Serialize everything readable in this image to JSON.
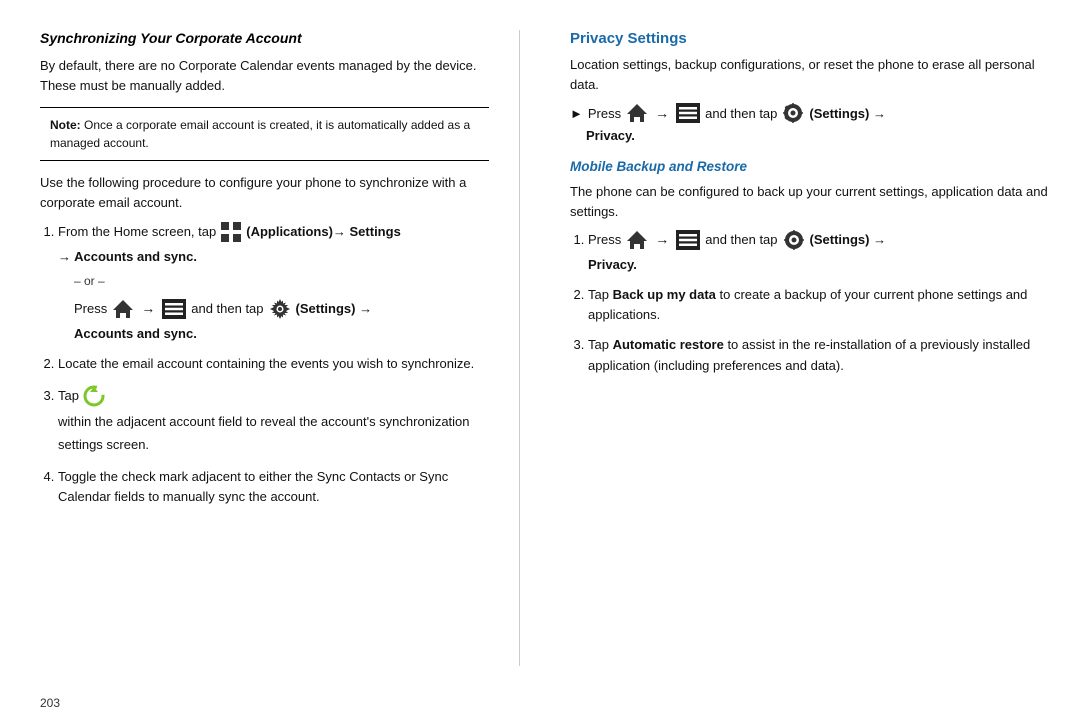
{
  "left": {
    "title": "Synchronizing Your Corporate Account",
    "intro": "By default, there are no Corporate Calendar events managed by the device. These must be manually added.",
    "note_label": "Note:",
    "note_text": "Once a corporate email account is created, it is automatically added as a managed account.",
    "procedure_intro": "Use the following procedure to configure your phone to synchronize with a corporate email account.",
    "steps": [
      {
        "num": "1.",
        "text_before_icon": "From the Home screen, tap",
        "app_icon": "grid-icon",
        "bold_text": "(Applications)→ Settings → Accounts and sync",
        "or_text": "– or –",
        "press_text": "Press",
        "and_then": "and then tap",
        "settings_label": "(Settings) →",
        "accounts_sync": "Accounts and sync"
      },
      {
        "num": "2.",
        "text": "Locate the email account containing the events you wish to synchronize."
      },
      {
        "num": "3.",
        "text_before_icon": "Tap",
        "text_after_icon": "within the adjacent account field to reveal the account's synchronization settings screen."
      },
      {
        "num": "4.",
        "text": "Toggle the check mark adjacent to either the Sync Contacts or Sync Calendar fields to manually sync the account."
      }
    ]
  },
  "right": {
    "title": "Privacy Settings",
    "intro": "Location settings, backup configurations, or reset the phone to erase all personal data.",
    "press_text": "Press",
    "and_then": "and then tap",
    "settings_label": "(Settings) →",
    "privacy_label": "Privacy.",
    "subsection_title": "Mobile Backup and Restore",
    "sub_intro": "The phone can be configured to back up your current settings, application data and settings.",
    "steps": [
      {
        "num": "1.",
        "press_text": "Press",
        "and_then": "and then tap",
        "settings_label": "(Settings) →",
        "privacy_label": "Privacy."
      },
      {
        "num": "2.",
        "text_before": "Tap",
        "bold_text": "Back up my data",
        "text_after": "to create a backup of your current phone settings and applications."
      },
      {
        "num": "3.",
        "text_before": "Tap",
        "bold_text": "Automatic restore",
        "text_after": "to assist in the re-installation of a previously installed application (including preferences and data)."
      }
    ]
  },
  "footer": {
    "page_number": "203"
  }
}
